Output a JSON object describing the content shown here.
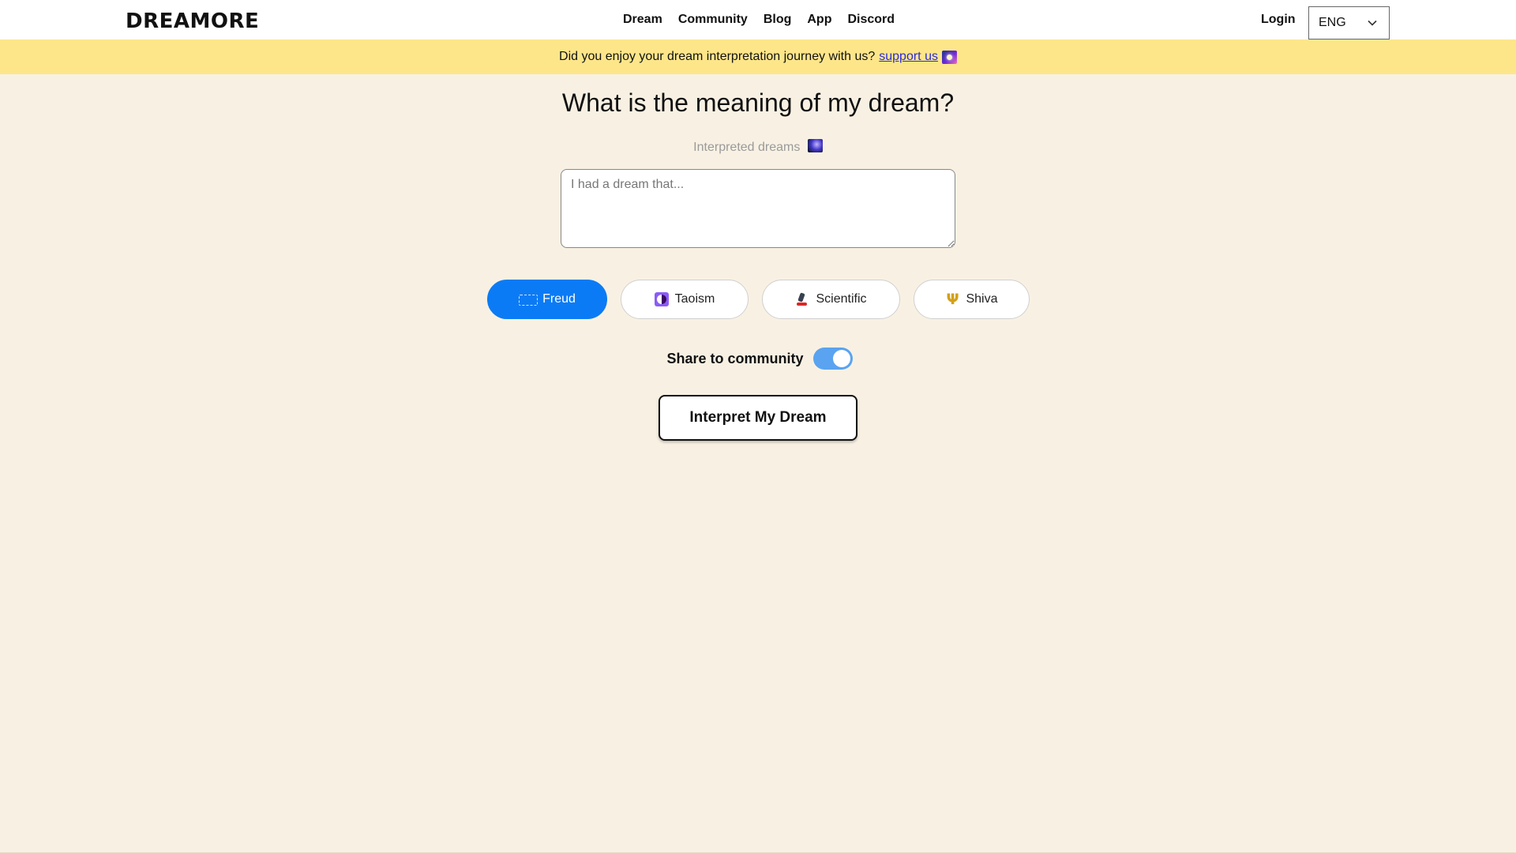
{
  "header": {
    "logo": "DREAMORE",
    "nav": [
      "Dream",
      "Community",
      "Blog",
      "App",
      "Discord"
    ],
    "login": "Login",
    "language": "ENG"
  },
  "banner": {
    "text": "Did you enjoy your dream interpretation journey with us?",
    "link": "support us"
  },
  "main": {
    "title": "What is the meaning of my dream?",
    "subtitle": "Interpreted dreams",
    "input_placeholder": "I had a dream that...",
    "input_value": "",
    "styles": [
      {
        "label": "Freud",
        "selected": true
      },
      {
        "label": "Taoism",
        "selected": false
      },
      {
        "label": "Scientific",
        "selected": false
      },
      {
        "label": "Shiva",
        "selected": false
      }
    ],
    "share_label": "Share to community",
    "share_enabled": true,
    "submit_label": "Interpret My Dream"
  },
  "colors": {
    "background": "#f8f1e3",
    "banner": "#fde68a",
    "accent": "#0b7bf5",
    "toggle_on": "#5aa3f0"
  }
}
